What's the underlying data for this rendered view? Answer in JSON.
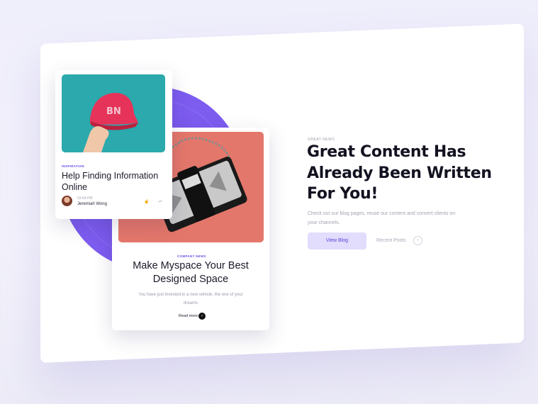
{
  "hero": {
    "eyebrow": "GREAT NEWS",
    "headline": "Great Content Has Already Been Written For You!",
    "subtitle": "Check out our blog pages, reuse our content and convert clients on your channels.",
    "primary_button": "View Blog",
    "secondary_button": "Recent Posts"
  },
  "front_card": {
    "category": "INSPIRATION",
    "title": "Help Finding Information Online",
    "time": "03:04 PM",
    "author": "Jeremiah Wong"
  },
  "back_card": {
    "category": "COMPANY NEWS",
    "title": "Make Myspace Your Best Designed Space",
    "description": "You have just invested in a new vehicle, the one of your dreams",
    "read_more": "Read more"
  },
  "icons": {
    "like": "thumbs-up-icon",
    "share": "share-icon",
    "arrow": "arrow-right-icon"
  },
  "colors": {
    "accent": "#7d5cf0",
    "button_bg": "#e2dcfd",
    "button_text": "#5a44d6"
  }
}
